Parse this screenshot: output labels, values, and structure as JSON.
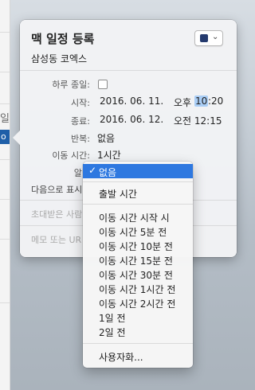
{
  "background_calendar": {
    "day_label": "일",
    "selected_label": "o"
  },
  "popover": {
    "title": "맥 일정 등록",
    "location": "삼성동 코엑스",
    "calendar_color": "#243a6e",
    "rows": {
      "all_day": {
        "label": "하루 종일:"
      },
      "start": {
        "label": "시작:",
        "date": "2016. 06. 11.",
        "ampm": "오후",
        "hour": "10",
        "minute": ":20"
      },
      "end": {
        "label": "종료:",
        "date": "2016. 06. 12.",
        "time": "오전 12:15"
      },
      "repeat": {
        "label": "반복:",
        "value": "없음"
      },
      "travel": {
        "label": "이동 시간:",
        "value": "1시간"
      },
      "alert": {
        "label": "알림"
      },
      "show_as": {
        "label": "다음으로 표시"
      }
    },
    "invitees_placeholder": "초대받은 사람",
    "notes_placeholder": "메모 또는 UR"
  },
  "dropdown": {
    "accent": "#2e78e0",
    "selected": "없음",
    "items": {
      "none": "없음",
      "departure": "출발 시간",
      "travel_start": "이동 시간 시작 시",
      "travel_5": "이동 시간 5분 전",
      "travel_10": "이동 시간 10분 전",
      "travel_15": "이동 시간 15분 전",
      "travel_30": "이동 시간 30분 전",
      "travel_1h": "이동 시간 1시간 전",
      "travel_2h": "이동 시간 2시간 전",
      "day_1": "1일 전",
      "day_2": "2일 전",
      "custom": "사용자화..."
    }
  }
}
